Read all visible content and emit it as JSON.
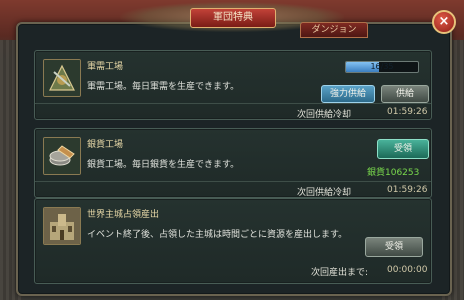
{
  "dialog": {
    "title": "軍団特典",
    "tab_label": "ダンジョン",
    "close_glyph": "×"
  },
  "cards": [
    {
      "title": "軍需工場",
      "description": "軍需工場。毎日軍需を生産できます。",
      "progress_text": "16/35",
      "progress_fraction": 0.457,
      "button_primary": "強力供給",
      "button_secondary": "供給",
      "timer_label": "次回供給冷却",
      "timer_value": "01:59:26",
      "icon": "shield-icon"
    },
    {
      "title": "銀貨工場",
      "description": "銀貨工場。毎日銀貨を生産できます。",
      "button_primary": "受領",
      "reward_text": "銀貨106253",
      "timer_label": "次回供給冷却",
      "timer_value": "01:59:26",
      "icon": "coin-icon"
    },
    {
      "title": "世界主城占領産出",
      "description": "イベント終了後、占領した主城は時間ごとに資源を産出します。",
      "button_primary": "受領",
      "timer_label": "次回産出まで:",
      "timer_value": "00:00:00",
      "icon": "castle-icon"
    }
  ],
  "colors": {
    "panel_bg": "#1c2426",
    "accent_red": "#c24238",
    "progress_blue": "#3b7fc1",
    "reward_green": "#79d84c"
  }
}
